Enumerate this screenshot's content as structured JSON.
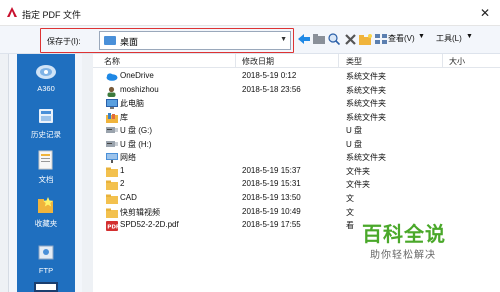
{
  "window": {
    "title": "指定 PDF 文件",
    "close_icon": "close-icon"
  },
  "toolbar": {
    "savein_label": "保存于(I):",
    "location_value": "桌面",
    "view_label": "查看(V)",
    "tools_label": "工具(L)"
  },
  "sidebar": {
    "items": [
      {
        "label": "A360",
        "icon": "cloud-icon"
      },
      {
        "label": "历史记录",
        "icon": "history-icon"
      },
      {
        "label": "文档",
        "icon": "documents-icon"
      },
      {
        "label": "收藏夹",
        "icon": "favorites-icon"
      },
      {
        "label": "FTP",
        "icon": "ftp-icon"
      }
    ]
  },
  "columns": {
    "name": "名称",
    "modified": "修改日期",
    "type": "类型",
    "size": "大小"
  },
  "files": [
    {
      "name": "OneDrive",
      "date": "2018-5-19 0:12",
      "type": "系统文件夹",
      "icon": "onedrive-icon"
    },
    {
      "name": "moshizhou",
      "date": "2018-5-18 23:56",
      "type": "系统文件夹",
      "icon": "user-icon"
    },
    {
      "name": "此电脑",
      "date": "",
      "type": "系统文件夹",
      "icon": "computer-icon"
    },
    {
      "name": "库",
      "date": "",
      "type": "系统文件夹",
      "icon": "library-icon"
    },
    {
      "name": "U 盘 (G:)",
      "date": "",
      "type": "U 盘",
      "icon": "usb-drive-icon"
    },
    {
      "name": "U 盘 (H:)",
      "date": "",
      "type": "U 盘",
      "icon": "usb-drive-icon"
    },
    {
      "name": "网络",
      "date": "",
      "type": "系统文件夹",
      "icon": "network-icon"
    },
    {
      "name": "1",
      "date": "2018-5-19 15:37",
      "type": "文件夹",
      "icon": "folder-icon"
    },
    {
      "name": "2",
      "date": "2018-5-19 15:31",
      "type": "文件夹",
      "icon": "folder-icon"
    },
    {
      "name": "CAD",
      "date": "2018-5-19 13:50",
      "type": "文",
      "icon": "folder-icon"
    },
    {
      "name": "快剪辑视频",
      "date": "2018-5-19 10:49",
      "type": "文",
      "icon": "folder-icon"
    },
    {
      "name": "SPD52-2-2D.pdf",
      "date": "2018-5-19 17:55",
      "type": "看",
      "icon": "pdf-icon"
    }
  ],
  "watermark": {
    "logo": "百科全说",
    "sub": "助你轻松解决"
  }
}
